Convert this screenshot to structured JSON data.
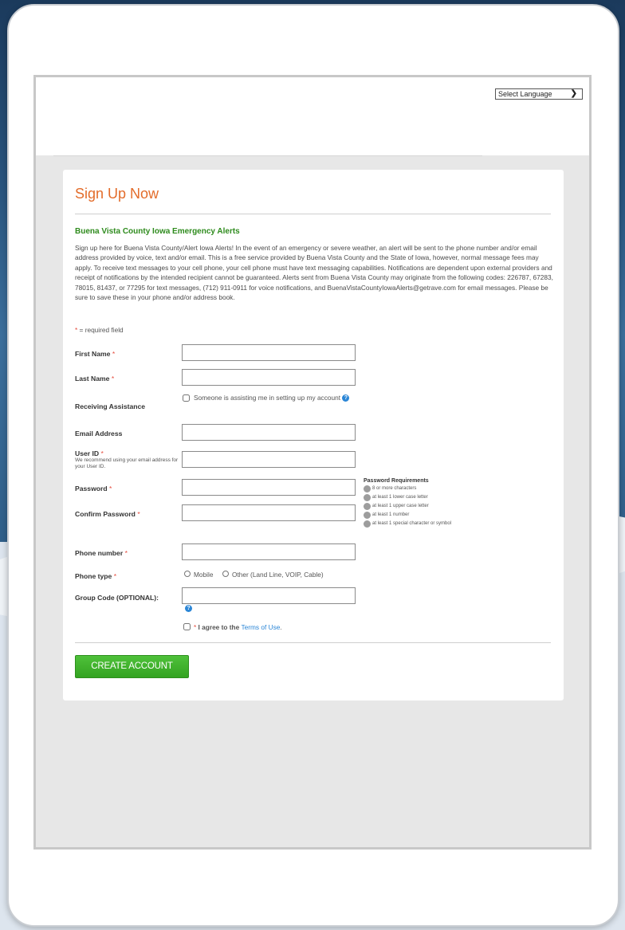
{
  "header": {
    "language_select": "Select Language"
  },
  "form": {
    "title": "Sign Up Now",
    "subtitle": "Buena Vista County Iowa Emergency Alerts",
    "intro": "Sign up here for Buena Vista County/Alert Iowa Alerts! In the event of an emergency or severe weather, an alert will be sent to the phone number and/or email address provided by voice, text and/or email. This is a free service provided by Buena Vista County and the State of Iowa, however, normal message fees may apply. To receive text messages to your cell phone, your cell phone must have text messaging capabilities. Notifications are dependent upon external providers and receipt of notifications by the intended recipient cannot be guaranteed. Alerts sent from Buena Vista County may originate from the following codes: 226787, 67283, 78015, 81437, or 77295 for text messages, (712) 911-0911 for voice notifications, and BuenaVistaCountyIowaAlerts@getrave.com for email messages. Please be sure to save these in your phone and/or address book.",
    "required_star": "*",
    "required_note": " = required field",
    "labels": {
      "first_name": "First Name",
      "last_name": "Last Name",
      "receiving_assistance": "Receiving Assistance",
      "email": "Email Address",
      "user_id": "User ID",
      "user_id_hint": "We recommend using your email address for your User ID.",
      "password": "Password",
      "confirm_password": "Confirm Password",
      "phone_number": "Phone number",
      "phone_type": "Phone type",
      "group_code": "Group Code (OPTIONAL):"
    },
    "assistance_text": "Someone is assisting me in setting up my account",
    "info_glyph": "?",
    "password_requirements": {
      "title": "Password Requirements",
      "items": [
        "8 or more characters",
        "at least 1 lower case letter",
        "at least 1 upper case letter",
        "at least 1 number",
        "at least 1 special character or symbol"
      ]
    },
    "phone_types": [
      "Mobile",
      "Other (Land Line, VOIP, Cable)"
    ],
    "agree_prefix": "I agree to the ",
    "terms_link": "Terms of Use",
    "agree_suffix": ".",
    "submit_label": "CREATE ACCOUNT"
  },
  "colors": {
    "title": "#e36c2a",
    "subtitle": "#2e8b1d",
    "button": "#3fb22b",
    "link": "#2b86d6",
    "required": "#e54a3c"
  }
}
